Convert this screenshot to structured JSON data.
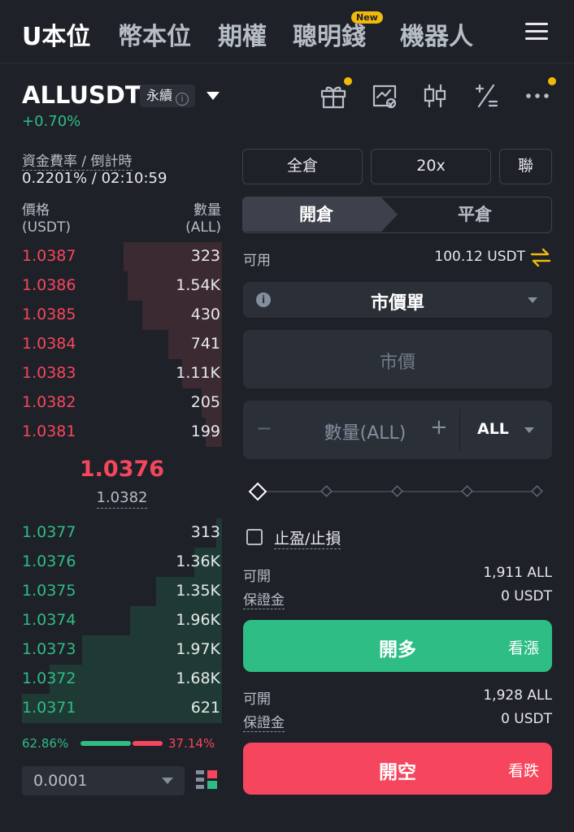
{
  "nav": {
    "tabs": [
      "U本位",
      "幣本位",
      "期權",
      "聰明錢",
      "機器人"
    ],
    "new_badge": "New",
    "menu_icon": "hamburger-menu-icon"
  },
  "symbol": {
    "name": "ALLUSDT",
    "contract_type": "永續",
    "change": "+0.70%",
    "icons": [
      "gift-icon",
      "chart-settings-icon",
      "candlestick-icon",
      "calculator-icon",
      "more-icon"
    ]
  },
  "funding": {
    "label": "資金費率 / 倒計時",
    "value": "0.2201% / 02:10:59"
  },
  "orderbook": {
    "price_header": "價格",
    "price_unit": "(USDT)",
    "qty_header": "數量",
    "qty_unit": "(ALL)",
    "asks": [
      {
        "price": "1.0387",
        "qty": "323",
        "depth": 0.49
      },
      {
        "price": "1.0386",
        "qty": "1.54K",
        "depth": 0.47
      },
      {
        "price": "1.0385",
        "qty": "430",
        "depth": 0.4
      },
      {
        "price": "1.0384",
        "qty": "741",
        "depth": 0.27
      },
      {
        "price": "1.0383",
        "qty": "1.11K",
        "depth": 0.2
      },
      {
        "price": "1.0382",
        "qty": "205",
        "depth": 0.1
      },
      {
        "price": "1.0381",
        "qty": "199",
        "depth": 0.08
      }
    ],
    "last_price": "1.0376",
    "mark_price": "1.0382",
    "bids": [
      {
        "price": "1.0377",
        "qty": "313",
        "depth": 0.03
      },
      {
        "price": "1.0376",
        "qty": "1.36K",
        "depth": 0.14
      },
      {
        "price": "1.0375",
        "qty": "1.35K",
        "depth": 0.33
      },
      {
        "price": "1.0374",
        "qty": "1.96K",
        "depth": 0.46
      },
      {
        "price": "1.0373",
        "qty": "1.97K",
        "depth": 0.7
      },
      {
        "price": "1.0372",
        "qty": "1.68K",
        "depth": 0.86
      },
      {
        "price": "1.0371",
        "qty": "621",
        "depth": 1.0
      }
    ],
    "buy_ratio": "62.86%",
    "sell_ratio": "37.14%",
    "precision": "0.0001"
  },
  "trade": {
    "margin_mode": "全倉",
    "leverage": "20x",
    "asset_mode": "聯",
    "open_tab": "開倉",
    "close_tab": "平倉",
    "available_label": "可用",
    "available_value": "100.12 USDT",
    "order_type": "市價單",
    "price_placeholder": "市價",
    "qty_placeholder": "數量(ALL)",
    "qty_unit": "ALL",
    "tpsl_label": "止盈/止損",
    "long": {
      "open_label": "可開",
      "open_value": "1,911 ALL",
      "margin_label": "保證金",
      "margin_value": "0 USDT",
      "button": "開多",
      "hint": "看漲"
    },
    "short": {
      "open_label": "可開",
      "open_value": "1,928 ALL",
      "margin_label": "保證金",
      "margin_value": "0 USDT",
      "button": "開空",
      "hint": "看跌"
    }
  },
  "colors": {
    "green": "#2ebd85",
    "red": "#f6465d",
    "accent": "#f0b90b",
    "background": "#1e2128"
  }
}
